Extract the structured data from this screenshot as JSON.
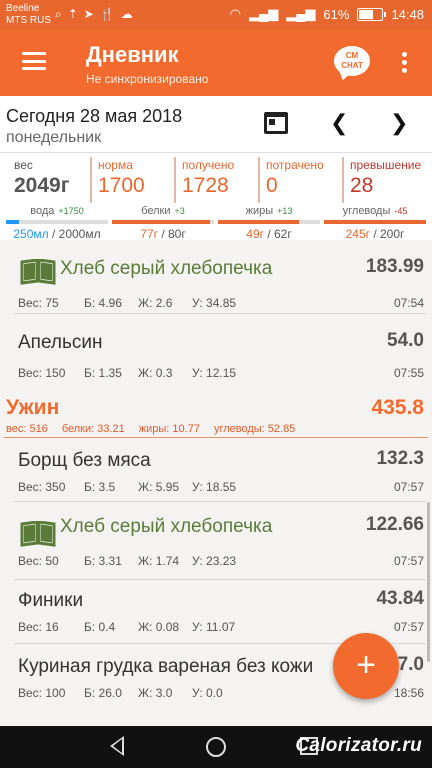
{
  "status_bar": {
    "carrier1": "Beeline",
    "carrier2": "MTS RUS",
    "battery_percent": "61%",
    "battery_level": 0.61,
    "time": "14:48"
  },
  "app_bar": {
    "title": "Дневник",
    "subtitle": "Не синхронизировано",
    "chat_line1": "CM",
    "chat_line2": "CHAT"
  },
  "date_bar": {
    "date": "Сегодня 28 мая 2018",
    "weekday": "понедельник",
    "prev": "‹",
    "next": "›"
  },
  "stats": [
    {
      "label": "вес",
      "value": "2049г",
      "color": "#555555",
      "value_color": "#555555"
    },
    {
      "label": "норма",
      "value": "1700",
      "color": "#e8672f",
      "value_color": "#e8672f"
    },
    {
      "label": "получено",
      "value": "1728",
      "color": "#e8672f",
      "value_color": "#e8672f"
    },
    {
      "label": "потрачено",
      "value": "0",
      "color": "#e8672f",
      "value_color": "#e8672f"
    },
    {
      "label": "превышение",
      "value": "28",
      "color": "#c0392b",
      "value_color": "#c0392b"
    }
  ],
  "macros": [
    {
      "label": "вода",
      "delta": "+1750",
      "delta_color": "#3a8a3a",
      "current": "250мл",
      "total": " / 2000мл",
      "current_color": "#2196f3",
      "bar_color": "#2196f3",
      "progress": 0.125
    },
    {
      "label": "белки",
      "delta": "+3",
      "delta_color": "#3a8a3a",
      "current": "77г",
      "total": " / 80г",
      "current_color": "#e8672f",
      "bar_color": "#e8672f",
      "progress": 0.96
    },
    {
      "label": "жиры",
      "delta": "+13",
      "delta_color": "#3a8a3a",
      "current": "49г",
      "total": " / 62г",
      "current_color": "#e8672f",
      "bar_color": "#e8672f",
      "progress": 0.79
    },
    {
      "label": "углеводы",
      "delta": "-45",
      "delta_color": "#c0392b",
      "current": "245г",
      "total": " / 200г",
      "current_color": "#e8672f",
      "bar_color": "#e8672f",
      "progress": 1.0
    }
  ],
  "list": {
    "items": [
      {
        "name": "Хлеб серый хлебопечка",
        "kcal": "183.99",
        "ves": "Вес: 75",
        "b": "Б: 4.96",
        "zh": "Ж: 2.6",
        "u": "У: 34.85",
        "time": "07:54",
        "book": true
      },
      {
        "name": "Апельсин",
        "kcal": "54.0",
        "ves": "Вес: 150",
        "b": "Б: 1.35",
        "zh": "Ж: 0.3",
        "u": "У: 12.15",
        "time": "07:55",
        "book": false
      }
    ],
    "meal": {
      "title": "Ужин",
      "kcal": "435.8",
      "ves": "вес: 516",
      "b": "белки: 33.21",
      "zh": "жиры: 10.77",
      "u": "углеводы: 52.85"
    },
    "dinner_items": [
      {
        "name": "Борщ без мяса",
        "kcal": "132.3",
        "ves": "Вес: 350",
        "b": "Б: 3.5",
        "zh": "Ж: 5.95",
        "u": "У: 18.55",
        "time": "07:57",
        "book": false
      },
      {
        "name": "Хлеб серый хлебопечка",
        "kcal": "122.66",
        "ves": "Вес: 50",
        "b": "Б: 3.31",
        "zh": "Ж: 1.74",
        "u": "У: 23.23",
        "time": "07:57",
        "book": true
      },
      {
        "name": "Финики",
        "kcal": "43.84",
        "ves": "Вес: 16",
        "b": "Б: 0.4",
        "zh": "Ж: 0.08",
        "u": "У: 11.07",
        "time": "07:57",
        "book": false
      },
      {
        "name": "Куриная грудка вареная без кожи",
        "kcal": "137.0",
        "ves": "Вес: 100",
        "b": "Б: 26.0",
        "zh": "Ж: 3.0",
        "u": "У: 0.0",
        "time": "18:56",
        "book": false
      }
    ]
  },
  "fab": {
    "label": "+"
  },
  "watermark": "Calorizator.ru"
}
